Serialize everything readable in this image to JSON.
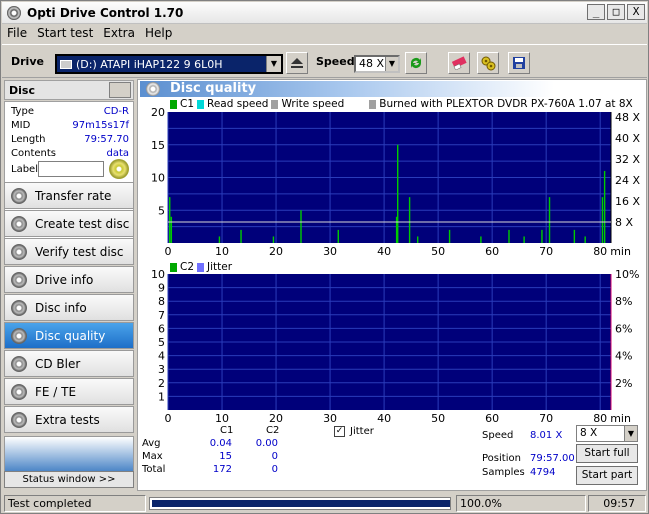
{
  "window": {
    "title": "Opti Drive Control 1.70",
    "controls": [
      "_",
      "□",
      "X"
    ]
  },
  "menu": [
    "File",
    "Start test",
    "Extra",
    "Help"
  ],
  "toolbar": {
    "drive_label": "Drive",
    "drive_value": "(D:)   ATAPI iHAP122   9 6L0H",
    "speed_label": "Speed",
    "speed_value": "48 X"
  },
  "disc": {
    "header": "Disc",
    "rows": [
      {
        "key": "Type",
        "value": "CD-R"
      },
      {
        "key": "MID",
        "value": "97m15s17f"
      },
      {
        "key": "Length",
        "value": "79:57.70"
      },
      {
        "key": "Contents",
        "value": "data"
      }
    ],
    "label_key": "Label"
  },
  "nav": [
    {
      "label": "Transfer rate",
      "active": false
    },
    {
      "label": "Create test disc",
      "active": false
    },
    {
      "label": "Verify test disc",
      "active": false
    },
    {
      "label": "Drive info",
      "active": false
    },
    {
      "label": "Disc info",
      "active": false
    },
    {
      "label": "Disc quality",
      "active": true
    },
    {
      "label": "CD Bler",
      "active": false
    },
    {
      "label": "FE / TE",
      "active": false
    },
    {
      "label": "Extra tests",
      "active": false
    }
  ],
  "status_window_button": "Status window >>",
  "panel_title": "Disc quality",
  "chart1_legend": {
    "c1": "C1",
    "read_speed": "Read speed",
    "write_speed": "Write speed",
    "burned": "Burned with PLEXTOR DVDR   PX-760A  1.07 at 8X"
  },
  "chart2_legend": {
    "c2": "C2",
    "jitter": "Jitter"
  },
  "colors": {
    "plot_bg": "#00007a",
    "grid": "#2a3cba",
    "c1": "#00cc00",
    "read": "#00d8d8",
    "speed_line": "#d8d8d8",
    "jitter_axis": "#d8006a"
  },
  "chart_data": [
    {
      "type": "bar",
      "title": "",
      "x_ticks": [
        "0",
        "10",
        "20",
        "30",
        "40",
        "50",
        "60",
        "70",
        "80"
      ],
      "x_unit": "min",
      "xlim": [
        0,
        82
      ],
      "y_ticks": [
        "5",
        "10",
        "15",
        "20"
      ],
      "ylim": [
        0,
        20
      ],
      "y2_ticks": [
        "8 X",
        "16 X",
        "24 X",
        "32 X",
        "40 X",
        "48 X"
      ],
      "y2lim": [
        0,
        48
      ],
      "series": [
        {
          "name": "C1",
          "x": [
            0.3,
            0.6,
            9.5,
            13.5,
            19.5,
            24.6,
            31.5,
            42.3,
            42.5,
            44.7,
            46.2,
            52.1,
            57.9,
            63.1,
            65.9,
            69.2,
            70.6,
            75.2,
            77.2,
            80.4,
            80.8
          ],
          "values": [
            7,
            4,
            1,
            2,
            1,
            5,
            2,
            4,
            15,
            7,
            1,
            2,
            1,
            2,
            1,
            2,
            7,
            2,
            1,
            7,
            11
          ]
        },
        {
          "name": "Write speed",
          "x": [
            0,
            82
          ],
          "values": [
            8,
            8
          ]
        }
      ]
    },
    {
      "type": "bar",
      "x_ticks": [
        "0",
        "10",
        "20",
        "30",
        "40",
        "50",
        "60",
        "70",
        "80"
      ],
      "x_unit": "min",
      "xlim": [
        0,
        82
      ],
      "y_ticks": [
        "1",
        "2",
        "3",
        "4",
        "5",
        "6",
        "7",
        "8",
        "9",
        "10"
      ],
      "ylim": [
        0,
        10
      ],
      "y2_ticks": [
        "2%",
        "4%",
        "6%",
        "8%",
        "10%"
      ],
      "series": [
        {
          "name": "C2",
          "x": [],
          "values": []
        }
      ]
    }
  ],
  "stats": {
    "col_c1": "C1",
    "col_c2": "C2",
    "rows": [
      {
        "label": "Avg",
        "c1": "0.04",
        "c2": "0.00"
      },
      {
        "label": "Max",
        "c1": "15",
        "c2": "0"
      },
      {
        "label": "Total",
        "c1": "172",
        "c2": "0"
      }
    ],
    "jitter_check": "Jitter",
    "speed_label": "Speed",
    "speed_value": "8.01 X",
    "position_label": "Position",
    "position_value": "79:57.00",
    "samples_label": "Samples",
    "samples_value": "4794",
    "x_select": "8 X",
    "start_full": "Start full",
    "start_part": "Start part"
  },
  "statusbar": {
    "text": "Test completed",
    "progress": 1.0,
    "percent": "100.0%",
    "time": "09:57"
  }
}
